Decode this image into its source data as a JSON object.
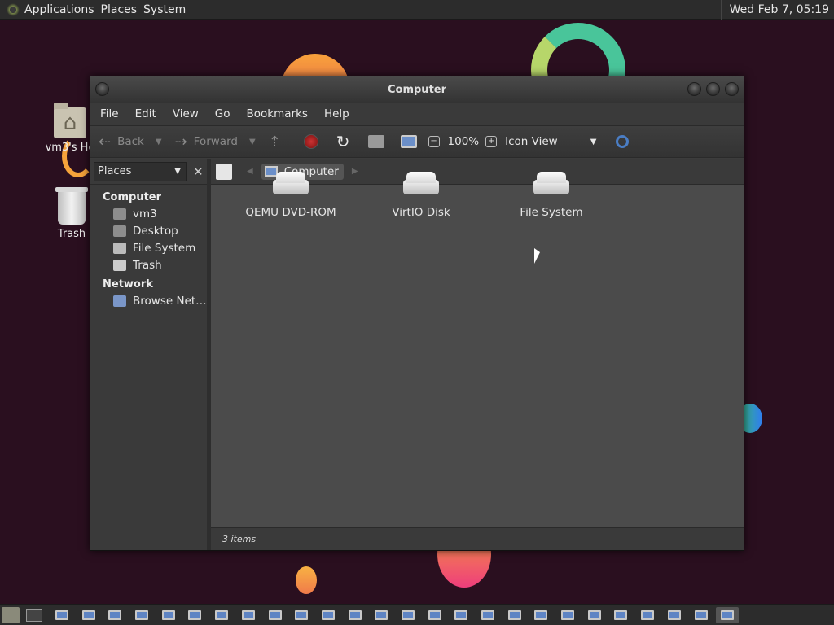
{
  "top_panel": {
    "menus": [
      "Applications",
      "Places",
      "System"
    ],
    "clock": "Wed Feb  7, 05:19"
  },
  "desktop": {
    "icons": [
      {
        "label": "vm3's Ho",
        "icon": "home-folder-icon"
      },
      {
        "label": "Trash",
        "icon": "trash-icon"
      }
    ]
  },
  "window": {
    "title": "Computer",
    "menubar": [
      "File",
      "Edit",
      "View",
      "Go",
      "Bookmarks",
      "Help"
    ],
    "toolbar": {
      "back": "Back",
      "forward": "Forward",
      "zoom": "100%",
      "view_mode": "Icon View"
    },
    "sidebar": {
      "selector": "Places",
      "sections": [
        {
          "title": "Computer",
          "items": [
            "vm3",
            "Desktop",
            "File System",
            "Trash"
          ]
        },
        {
          "title": "Network",
          "items": [
            "Browse Net…"
          ]
        }
      ]
    },
    "location": "Computer",
    "items": [
      {
        "label": "QEMU DVD-ROM",
        "icon": "optical-drive-icon"
      },
      {
        "label": "VirtIO Disk",
        "icon": "hard-disk-icon"
      },
      {
        "label": "File System",
        "icon": "hard-disk-icon"
      }
    ],
    "status": "3 items"
  },
  "colors": {
    "desktop_bg": "#2a0f1f",
    "window_bg": "#3c3c3c",
    "content_bg": "#4b4b4b"
  }
}
